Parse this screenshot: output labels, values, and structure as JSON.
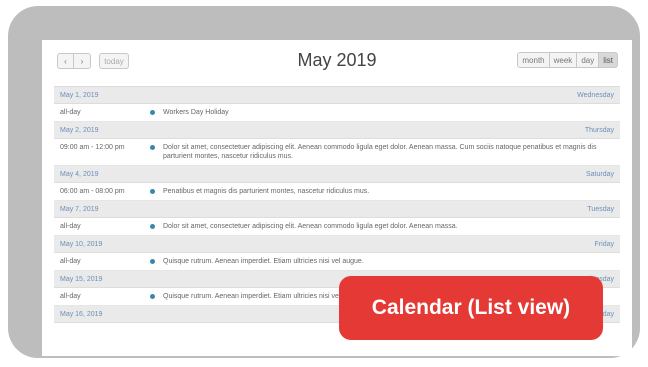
{
  "toolbar": {
    "prev_label": "‹",
    "next_label": "›",
    "today_label": "today",
    "title": "May 2019",
    "views": [
      "month",
      "week",
      "day",
      "list"
    ]
  },
  "days": [
    {
      "date": "May 1, 2019",
      "weekday": "Wednesday",
      "events": [
        {
          "time": "all-day",
          "title": "Workers Day Holiday"
        }
      ]
    },
    {
      "date": "May 2, 2019",
      "weekday": "Thursday",
      "events": [
        {
          "time": "09:00 am - 12:00 pm",
          "title": "Dolor sit amet, consectetuer adipiscing elit. Aenean commodo ligula eget dolor. Aenean massa. Cum sociis natoque penatibus et magnis dis parturient montes, nascetur ridiculus mus."
        }
      ]
    },
    {
      "date": "May 4, 2019",
      "weekday": "Saturday",
      "events": [
        {
          "time": "06:00 am - 08:00 pm",
          "title": "Penatibus et magnis dis parturient montes, nascetur ridiculus mus."
        }
      ]
    },
    {
      "date": "May 7, 2019",
      "weekday": "Tuesday",
      "events": [
        {
          "time": "all-day",
          "title": "Dolor sit amet, consectetuer adipiscing elit. Aenean commodo ligula eget dolor. Aenean massa."
        }
      ]
    },
    {
      "date": "May 10, 2019",
      "weekday": "Friday",
      "events": [
        {
          "time": "all-day",
          "title": "Quisque rutrum. Aenean imperdiet. Etiam ultricies nisi vel augue."
        }
      ]
    },
    {
      "date": "May 15, 2019",
      "weekday": "Wednesday",
      "events": [
        {
          "time": "all-day",
          "title": "Quisque rutrum. Aenean imperdiet. Etiam ultricies nisi vel augue."
        }
      ]
    },
    {
      "date": "May 16, 2019",
      "weekday": "Thursday",
      "events": []
    }
  ],
  "badge": {
    "label": "Calendar (List view)"
  },
  "colors": {
    "frame": "#bdbdbd",
    "badge": "#e53935",
    "event_dot": "#3a87ad",
    "date_text": "#6c8fb8"
  }
}
